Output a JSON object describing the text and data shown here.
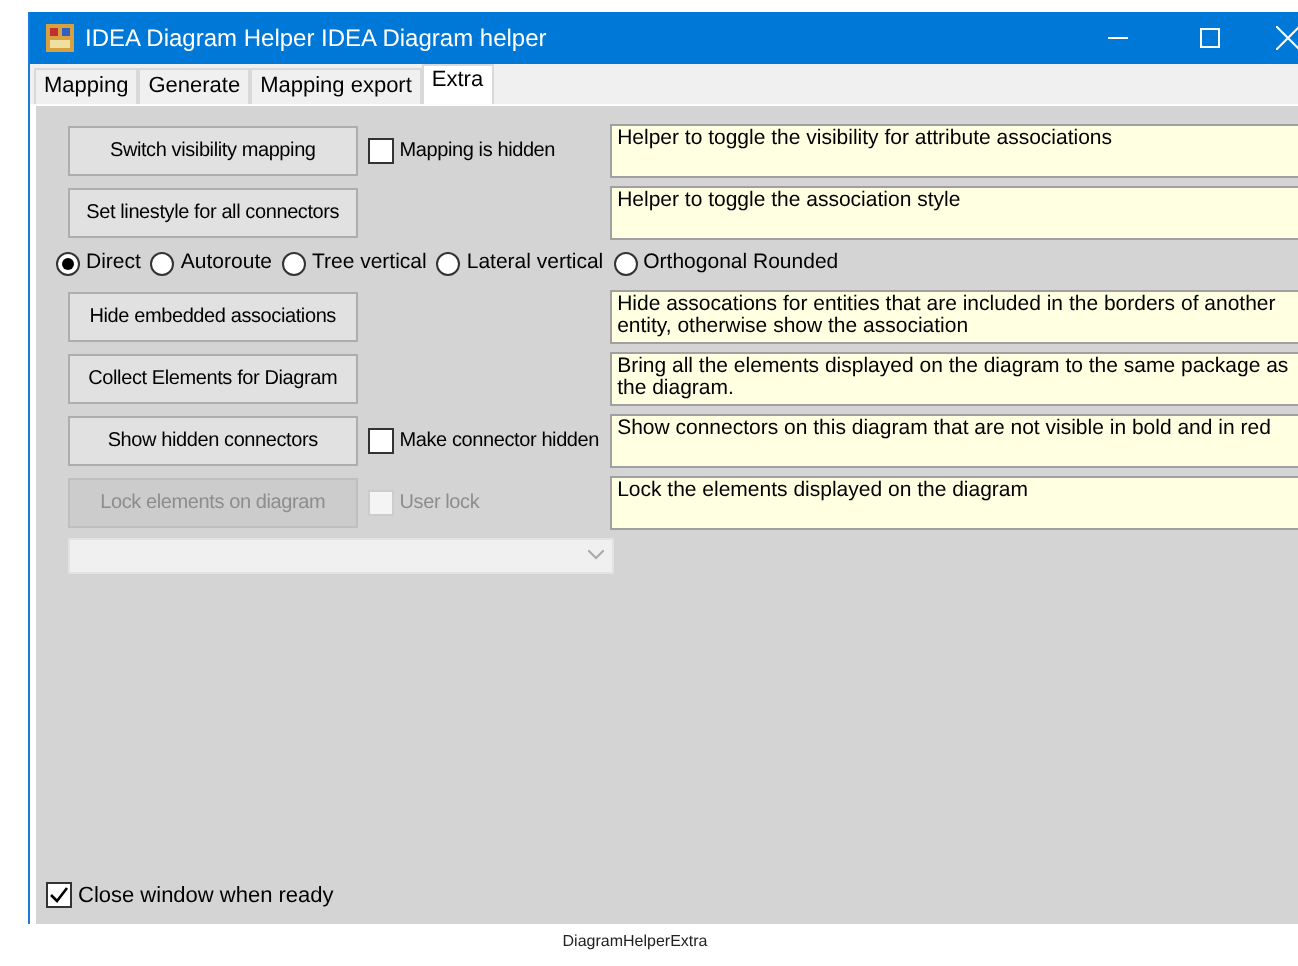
{
  "window": {
    "title": "IDEA Diagram Helper IDEA Diagram helper"
  },
  "tabs": [
    {
      "label": "Mapping",
      "selected": false
    },
    {
      "label": "Generate",
      "selected": false
    },
    {
      "label": "Mapping export",
      "selected": false
    },
    {
      "label": "Extra",
      "selected": true
    }
  ],
  "rows": [
    {
      "kind": "action",
      "button": {
        "label": "Switch visibility mapping",
        "disabled": false
      },
      "checkbox": {
        "label": "Mapping is hidden",
        "checked": false,
        "disabled": false
      },
      "help": "Helper to toggle the visibility for attribute associations"
    },
    {
      "kind": "action",
      "button": {
        "label": "Set linestyle for all connectors",
        "disabled": false
      },
      "help": "Helper to toggle the association style"
    },
    {
      "kind": "radios",
      "options": [
        {
          "label": "Direct",
          "selected": true
        },
        {
          "label": "Autoroute",
          "selected": false
        },
        {
          "label": "Tree vertical",
          "selected": false
        },
        {
          "label": "Lateral vertical",
          "selected": false
        },
        {
          "label": "Orthogonal Rounded",
          "selected": false
        }
      ]
    },
    {
      "kind": "action",
      "button": {
        "label": "Hide embedded associations",
        "disabled": false
      },
      "help": "Hide assocations for entities that are  included in the borders of another entity, otherwise show the association"
    },
    {
      "kind": "action",
      "button": {
        "label": "Collect Elements for Diagram",
        "disabled": false
      },
      "help": "Bring all the elements displayed on the diagram to the same package as the diagram."
    },
    {
      "kind": "action",
      "button": {
        "label": "Show hidden connectors",
        "disabled": false
      },
      "checkbox": {
        "label": "Make connector hidden",
        "checked": false,
        "disabled": false
      },
      "help": "Show connectors on this diagram that are not visible in bold and in red"
    },
    {
      "kind": "action",
      "button": {
        "label": "Lock elements on diagram",
        "disabled": true
      },
      "checkbox": {
        "label": "User lock",
        "checked": false,
        "disabled": true
      },
      "help": "Lock the elements displayed on the diagram"
    }
  ],
  "dropdown": {
    "disabled": true
  },
  "close_checkbox": {
    "label": "Close window when ready",
    "checked": true
  },
  "caption": "DiagramHelperExtra"
}
